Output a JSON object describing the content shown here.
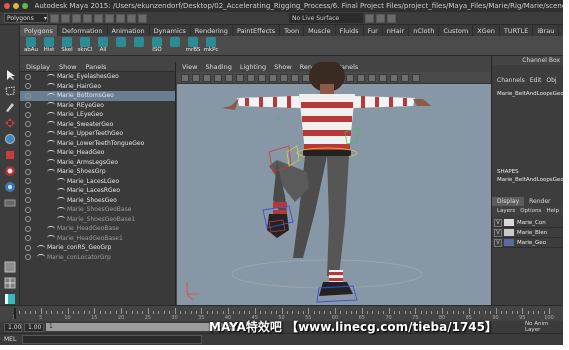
{
  "titlebar": {
    "title": "Autodesk Maya 2015: /Users/ekunzendorf/Desktop/02_Accelerating_Rigging_Process/6. Final Project Files/project_files/Maya_Files/Marie/Rig/Marie/scenes/2"
  },
  "status_line": {
    "menu_set": "Polygons",
    "live_surface": "No Live Surface"
  },
  "shelf": {
    "tabs": [
      "Polygons",
      "Deformation",
      "Animation",
      "Dynamics",
      "Rendering",
      "PaintEffects",
      "Toon",
      "Muscle",
      "Fluids",
      "Fur",
      "nHair",
      "nCloth",
      "Custom",
      "XGen",
      "TURTLE",
      "iBrau"
    ],
    "active_tab": 0,
    "items": [
      "abAu",
      "Hist",
      "Skel",
      "sknCl",
      "All",
      "",
      "",
      "ISO",
      "",
      "mrBS",
      "mkPc"
    ]
  },
  "outliner": {
    "menu": [
      "Display",
      "Show",
      "Panels"
    ],
    "rows": [
      {
        "label": "Marie_EyelashesGeo",
        "indent": 1,
        "selected": false,
        "dim": false
      },
      {
        "label": "Marie_HairGeo",
        "indent": 1,
        "selected": false,
        "dim": false
      },
      {
        "label": "Marie_BottomsGeo",
        "indent": 1,
        "selected": true,
        "dim": false
      },
      {
        "label": "Marie_REyeGeo",
        "indent": 1,
        "selected": false,
        "dim": false
      },
      {
        "label": "Marie_LEyeGeo",
        "indent": 1,
        "selected": false,
        "dim": false
      },
      {
        "label": "Marie_SweaterGeo",
        "indent": 1,
        "selected": false,
        "dim": false
      },
      {
        "label": "Marie_UpperTeethGeo",
        "indent": 1,
        "selected": false,
        "dim": false
      },
      {
        "label": "Marie_LowerTeethTongueGeo",
        "indent": 1,
        "selected": false,
        "dim": false
      },
      {
        "label": "Marie_HeadGeo",
        "indent": 1,
        "selected": false,
        "dim": false
      },
      {
        "label": "Marie_ArmsLegsGeo",
        "indent": 1,
        "selected": false,
        "dim": false
      },
      {
        "label": "Marie_ShoesGrp",
        "indent": 1,
        "selected": false,
        "dim": false
      },
      {
        "label": "Marie_LacesLGeo",
        "indent": 2,
        "selected": false,
        "dim": false
      },
      {
        "label": "Marie_LacesRGeo",
        "indent": 2,
        "selected": false,
        "dim": false
      },
      {
        "label": "Marie_ShoesGeo",
        "indent": 2,
        "selected": false,
        "dim": false
      },
      {
        "label": "Marie_ShoesGeoBase",
        "indent": 2,
        "selected": false,
        "dim": true
      },
      {
        "label": "Marie_ShoesGeoBase1",
        "indent": 2,
        "selected": false,
        "dim": true
      },
      {
        "label": "Marie_HeadGeoBase",
        "indent": 1,
        "selected": false,
        "dim": true
      },
      {
        "label": "Marie_HeadGeoBase1",
        "indent": 1,
        "selected": false,
        "dim": true
      },
      {
        "label": "Marie_conRS_GeoGrp",
        "indent": 0,
        "selected": false,
        "dim": false
      },
      {
        "label": "Marie_conLocatorGrp",
        "indent": 0,
        "selected": false,
        "dim": true
      }
    ]
  },
  "viewport": {
    "menu": [
      "View",
      "Shading",
      "Lighting",
      "Show",
      "Renderer",
      "Panels"
    ]
  },
  "channel_box": {
    "header": "Channel Box",
    "menu": [
      "Channels",
      "Edit",
      "Obj"
    ],
    "object": "Marie_BeltAndLoopsGeo",
    "shapes_label": "SHAPES",
    "shape_name": "Marie_BeltAndLoopsGeoSh",
    "layer_tabs": [
      "Display",
      "Render"
    ],
    "layer_menu": [
      "Layers",
      "Options",
      "Help"
    ],
    "layers": [
      {
        "v": "V",
        "name": "Marie_Con",
        "color": "#d8d8d8"
      },
      {
        "v": "V",
        "name": "Marie_Blen",
        "color": "#c9c9c9"
      },
      {
        "v": "V",
        "name": "Marie_Geo",
        "color": "#5a6a9c"
      }
    ]
  },
  "time_slider": {
    "ticks": [
      "1",
      "5",
      "10",
      "15",
      "20",
      "25",
      "30",
      "35",
      "40",
      "45",
      "50",
      "55",
      "60",
      "65",
      "70",
      "75",
      "80",
      "85",
      "90",
      "95",
      "100"
    ]
  },
  "range_slider": {
    "start": "1.00",
    "current": "1.00",
    "frame": "1",
    "end": "343",
    "anim_layers": "No Anim Layer"
  },
  "command_line": {
    "label": "MEL"
  },
  "watermark": {
    "text": "MAYA特效吧 【www.linecg.com/tieba/1745】"
  },
  "colors": {
    "viewport_bg": "#8797a6",
    "selection": "#6a7e93",
    "shelf_icon": "#2c8c94",
    "wire_red": "#d23a3a",
    "wire_blue": "#3c4fd8",
    "wire_yellow": "#e0d23a",
    "wire_green": "#3ac05a"
  }
}
